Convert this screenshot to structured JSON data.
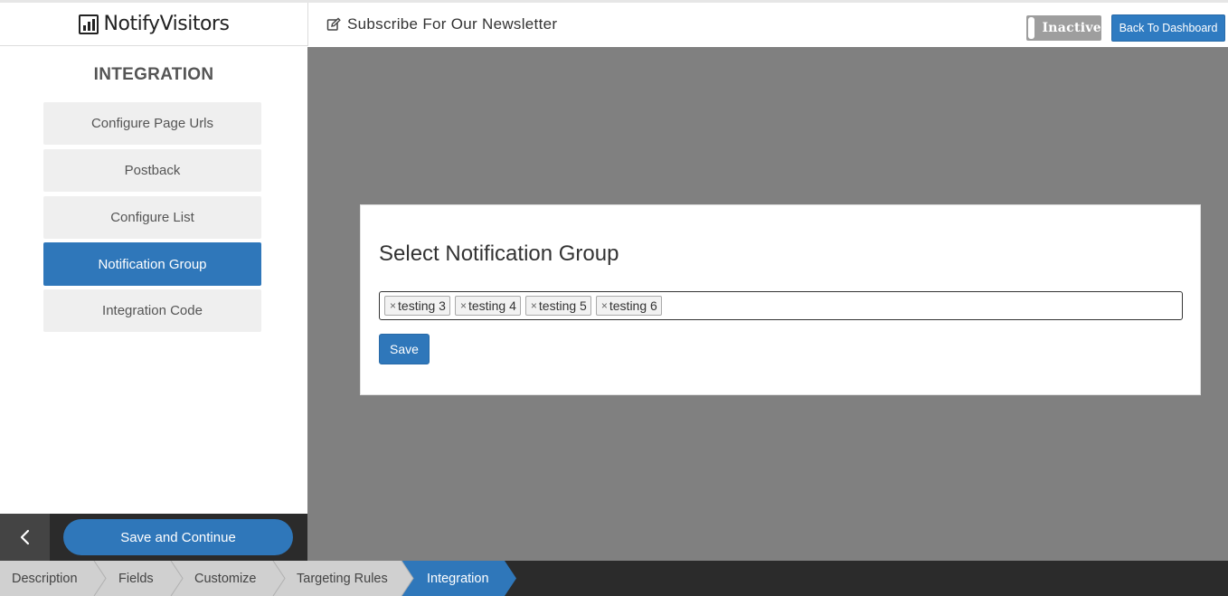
{
  "brand": {
    "name": "NotifyVisitors"
  },
  "header": {
    "title": "Subscribe For Our Newsletter",
    "status_toggle": "Inactive",
    "back_button": "Back To Dashboard"
  },
  "sidebar": {
    "title": "INTEGRATION",
    "items": [
      {
        "label": "Configure Page Urls",
        "active": false
      },
      {
        "label": "Postback",
        "active": false
      },
      {
        "label": "Configure List",
        "active": false
      },
      {
        "label": "Notification Group",
        "active": true
      },
      {
        "label": "Integration Code",
        "active": false
      }
    ],
    "save_continue": "Save and Continue"
  },
  "card": {
    "title": "Select Notification Group",
    "tags": [
      "testing 3",
      "testing 4",
      "testing 5",
      "testing 6"
    ],
    "save_button": "Save"
  },
  "steps": [
    {
      "label": "Description",
      "active": false
    },
    {
      "label": "Fields",
      "active": false
    },
    {
      "label": "Customize",
      "active": false
    },
    {
      "label": "Targeting Rules",
      "active": false
    },
    {
      "label": "Integration",
      "active": true
    }
  ],
  "colors": {
    "primary": "#2f77ba",
    "overlay": "#808080",
    "inactive_toggle": "#9e9e9e",
    "step_bg": "#d0d0d0",
    "footer_bg": "#2b2b2b"
  }
}
